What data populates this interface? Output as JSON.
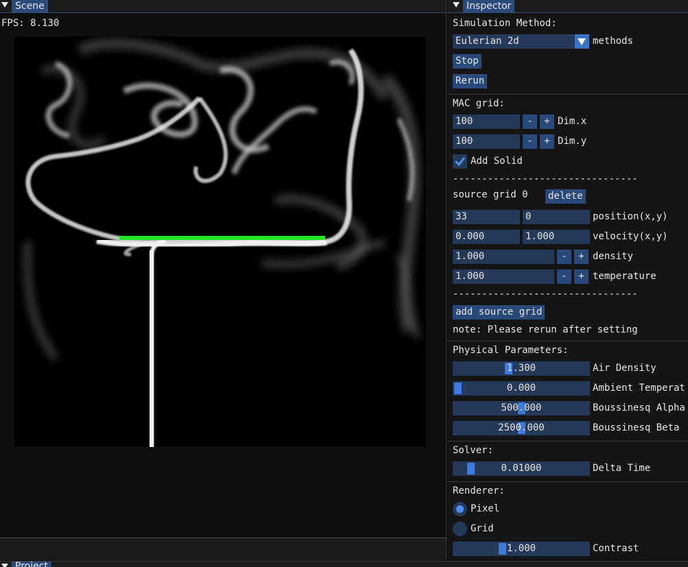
{
  "scene": {
    "title": "Scene",
    "fps": "FPS: 8.130"
  },
  "inspector": {
    "title": "Inspector",
    "simulation_method_label": "Simulation Method:",
    "method_value": "Eulerian 2d",
    "methods_label": "methods",
    "stop_label": "Stop",
    "rerun_label": "Rerun",
    "mac_grid_label": "MAC grid:",
    "dim_x": {
      "value": "100",
      "minus": "-",
      "plus": "+",
      "label": "Dim.x"
    },
    "dim_y": {
      "value": "100",
      "minus": "-",
      "plus": "+",
      "label": "Dim.y"
    },
    "add_solid": {
      "label": "Add Solid",
      "checked": true
    },
    "divider_text": "--------------------------------",
    "source_grid": {
      "title": "source grid 0",
      "delete_label": "delete",
      "position": {
        "x": "33",
        "y": "0",
        "label": "position(x,y)"
      },
      "velocity": {
        "x": "0.000",
        "y": "1.000",
        "label": "velocity(x,y)"
      },
      "density": {
        "value": "1.000",
        "minus": "-",
        "plus": "+",
        "label": "density"
      },
      "temperature": {
        "value": "1.000",
        "minus": "-",
        "plus": "+",
        "label": "temperature"
      }
    },
    "add_source_grid_label": "add source grid",
    "note": "note: Please rerun after setting",
    "physical": {
      "title": "Physical Parameters:",
      "air_density": {
        "value": "1.300",
        "label": "Air Density",
        "fraction": 0.4
      },
      "ambient_temperature": {
        "value": "0.000",
        "label": "Ambient Temperat",
        "fraction": 0.0
      },
      "boussinesq_alpha": {
        "value": "500.000",
        "label": "Boussinesq Alpha",
        "fraction": 0.5
      },
      "boussinesq_beta": {
        "value": "2500.000",
        "label": "Boussinesq Beta",
        "fraction": 0.5
      }
    },
    "solver": {
      "title": "Solver:",
      "delta_time": {
        "value": "0.01000",
        "label": "Delta Time",
        "fraction": 0.1
      }
    },
    "renderer": {
      "title": "Renderer:",
      "options": [
        "Pixel",
        "Grid"
      ],
      "selected": "Pixel",
      "contrast": {
        "value": "1.000",
        "label": "Contrast",
        "fraction": 0.35
      }
    }
  },
  "project": {
    "title": "Project"
  },
  "colors": {
    "accent": "#294a7a",
    "frame": "#243a58",
    "grab": "#3d7be0",
    "solid_bar": "#22e622",
    "smoke": "#ffffff"
  }
}
